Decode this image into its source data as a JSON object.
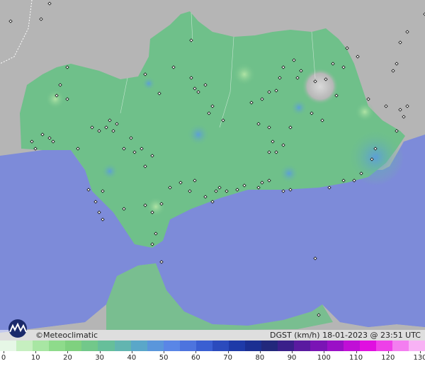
{
  "footer": {
    "credit": "©Meteoclimatic",
    "title": "DGST (km/h)  18-01-2023 @ 23:51 UTC"
  },
  "legend": {
    "ticks": [
      "0",
      "10",
      "20",
      "30",
      "40",
      "50",
      "60",
      "70",
      "80",
      "90",
      "100",
      "110",
      "120",
      "130"
    ],
    "colors": [
      "#e6f7e6",
      "#c6efc0",
      "#a8e6a3",
      "#8edb8b",
      "#7fd17f",
      "#72c88a",
      "#66bf9a",
      "#62b5b0",
      "#5aa7c9",
      "#5a96db",
      "#5a86e6",
      "#4d74de",
      "#3a5fd2",
      "#2b4bbd",
      "#1e3aa8",
      "#1b2f92",
      "#22287c",
      "#3a1f8a",
      "#5a1aa0",
      "#7a14b5",
      "#9a10c6",
      "#c00fd6",
      "#e010e0",
      "#ee40e8",
      "#f47ef0",
      "#f8b2f5"
    ]
  }
}
